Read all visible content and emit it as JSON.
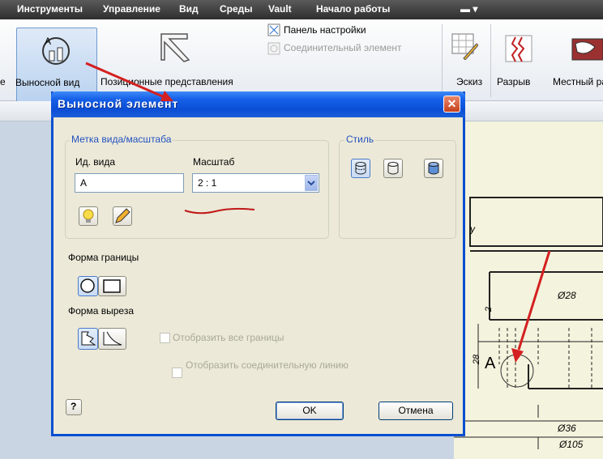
{
  "menubar": {
    "items": [
      "Инструменты",
      "Управление",
      "Вид",
      "Среды",
      "Vault",
      "Начало работы"
    ]
  },
  "ribbon": {
    "detail_view": "Выносной вид",
    "positional": "Позиционные представления",
    "edge_label": "е",
    "settings_panel": "Панель настройки",
    "connector": "Соединительный элемент",
    "sketch": "Эскиз",
    "break": "Разрыв",
    "local": "Местный ра"
  },
  "dialog": {
    "title": "Выносной элемент",
    "close": "✕",
    "label_group": "Метка вида/масштаба",
    "view_id_label": "Ид. вида",
    "view_id_value": "A",
    "scale_label": "Масштаб",
    "scale_value": "2 : 1",
    "style_group": "Стиль",
    "border_shape_label": "Форма границы",
    "cutout_shape_label": "Форма выреза",
    "show_all_borders": "Отобразить все границы",
    "show_connector_line": "Отобразить соединительную линию",
    "help": "?",
    "ok": "OK",
    "cancel": "Отмена"
  },
  "drawing": {
    "dim_28_h": "Ø28",
    "dim_2": "2",
    "dim_28_v": "28",
    "marker_a": "A",
    "dim_36": "Ø36",
    "dim_105": "Ø105"
  },
  "colors": {
    "titlebar": "#0b4ed6",
    "dialog_bg": "#ece9d8",
    "annotation_arrow": "#d42020",
    "drawing_bg": "#f4f3dd"
  }
}
